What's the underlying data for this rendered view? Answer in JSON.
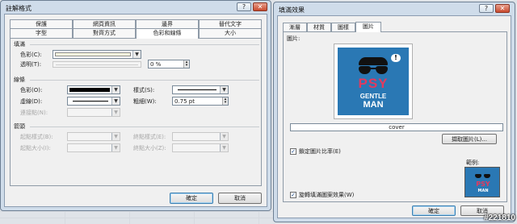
{
  "dialog_left": {
    "title": "註解格式",
    "tabs_top": [
      "保護",
      "網頁資訊",
      "邊界",
      "替代文字"
    ],
    "tabs_bottom": [
      "字型",
      "對齊方式",
      "色彩和線條",
      "大小"
    ],
    "active_tab": "色彩和線條",
    "fill": {
      "group": "填滿",
      "color_label": "色彩(C):",
      "color_value": "#ffffe1",
      "transparency_label": "透明(T):",
      "transparency_value": "0 %"
    },
    "line": {
      "group": "線條",
      "color_label": "色彩(O):",
      "color_value": "#000000",
      "style_label": "樣式(S):",
      "dash_label": "虛線(D):",
      "weight_label": "粗細(W):",
      "weight_value": "0.75 pt",
      "connector_label": "連接點(N):"
    },
    "arrows": {
      "group": "箭頭",
      "begin_style_label": "起點樣式(B):",
      "end_style_label": "終點樣式(E):",
      "begin_size_label": "起點大小(I):",
      "end_size_label": "終點大小(Z):"
    },
    "ok_label": "確定",
    "cancel_label": "取消",
    "help_icon": "?",
    "close_icon": "✕"
  },
  "dialog_right": {
    "title": "填滿效果",
    "tabs": [
      "漸層",
      "材質",
      "圖樣",
      "圖片"
    ],
    "active_tab": "圖片",
    "picture_label": "圖片:",
    "picture": {
      "headline": "PSY",
      "subline1": "GENTLE",
      "subline2": "MAN",
      "bubble": "!",
      "background": "#2a78b4"
    },
    "filename": "cover",
    "select_button": "擷取圖片(L)...",
    "lock_ratio_label": "鎖定圖片比率(E)",
    "lock_ratio_checked": true,
    "rotate_label": "旋轉填滿圖案效果(W)",
    "rotate_checked": true,
    "sample_label": "範例:",
    "ok_label": "確定",
    "cancel_label": "取消",
    "help_icon": "?",
    "close_icon": "✕"
  },
  "watermark": "#221810"
}
